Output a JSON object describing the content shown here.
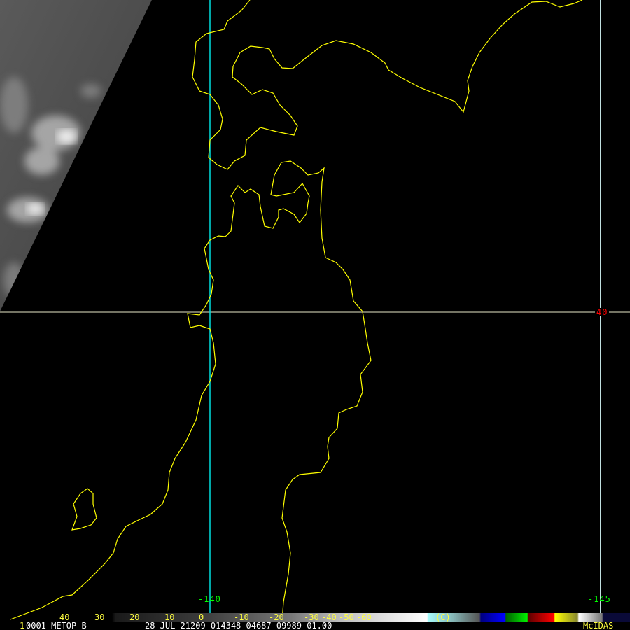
{
  "map": {
    "grid_labels": {
      "lon_140": "-140",
      "lon_145": "-145",
      "lat_40": "40"
    },
    "colors": {
      "coast": "#ffff00",
      "grid_lon": "#00e0e0",
      "lon_label": "#00ff00",
      "lat_label": "#ff0000"
    }
  },
  "colorbar": {
    "ticks": [
      "40",
      "30",
      "20",
      "10",
      "0",
      "-10",
      "-20",
      "-30",
      "-40",
      "-50",
      "-60"
    ],
    "unit": "(C)"
  },
  "status": {
    "frame": "1",
    "line": "0001 METOP-B",
    "datetime": "28 JUL 21209 014348 04687 09989 01.00",
    "brand": "McIDAS"
  }
}
